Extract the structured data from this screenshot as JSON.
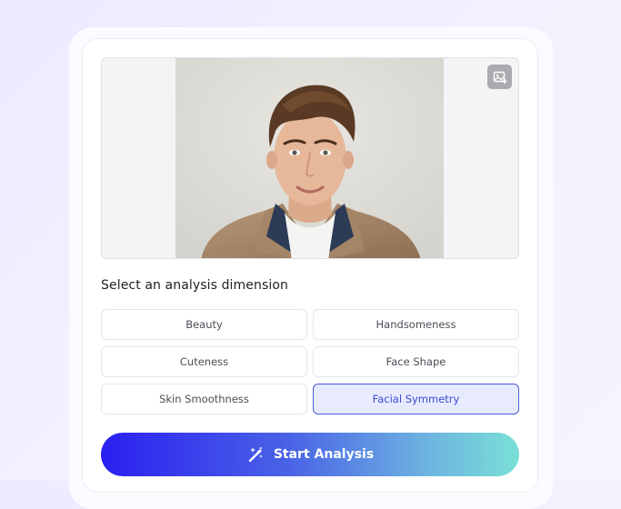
{
  "image_panel": {
    "photo": "portrait-of-young-man-in-trench-coat",
    "replace_icon": "image-replace-icon"
  },
  "analysis": {
    "title": "Select an analysis dimension",
    "options": [
      "Beauty",
      "Handsomeness",
      "Cuteness",
      "Face Shape",
      "Skin Smoothness",
      "Facial Symmetry"
    ],
    "selected": "Facial Symmetry"
  },
  "action": {
    "start_label": "Start Analysis",
    "icon": "magic-wand-icon"
  },
  "colors": {
    "accent": "#3a4bd0",
    "gradient_start": "#2a1ff0",
    "gradient_end": "#79e0d6"
  }
}
